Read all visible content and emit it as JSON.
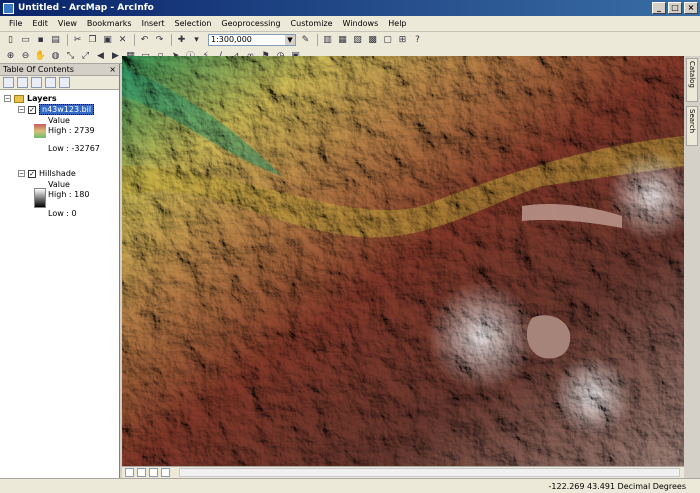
{
  "window": {
    "title": "Untitled - ArcMap - ArcInfo",
    "minimize": "_",
    "maximize": "□",
    "close": "×"
  },
  "menu": [
    "File",
    "Edit",
    "View",
    "Bookmarks",
    "Insert",
    "Selection",
    "Geoprocessing",
    "Customize",
    "Windows",
    "Help"
  ],
  "toolbar": {
    "scale_value": "1:300,000"
  },
  "toc": {
    "title": "Table Of Contents",
    "close": "×",
    "root": "Layers",
    "layers": [
      {
        "name": "n43w123.bil",
        "legend_heading": "Value",
        "high": "High : 2739",
        "low": "Low : -32767"
      },
      {
        "name": "Hillshade",
        "legend_heading": "Value",
        "high": "High : 180",
        "low": "Low : 0"
      }
    ]
  },
  "side_tabs": [
    "Catalog",
    "Search"
  ],
  "status": {
    "coordinates": "-122.269  43.491 Decimal Degrees"
  },
  "colors": {
    "title_start": "#0a246a",
    "title_end": "#3a6ea5",
    "selection": "#316ac5"
  }
}
